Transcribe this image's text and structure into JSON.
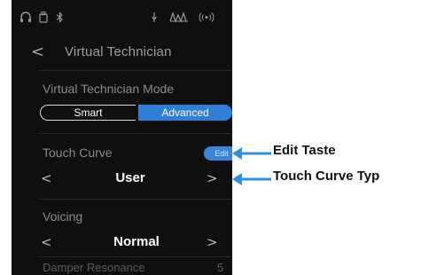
{
  "status_icons": [
    {
      "name": "headphones-icon",
      "glyph": "∩"
    },
    {
      "name": "usb-storage-icon",
      "glyph": "▯"
    },
    {
      "name": "bluetooth-icon",
      "glyph": "∗"
    },
    {
      "name": "microphone-icon",
      "glyph": "↓"
    },
    {
      "name": "metronome-icon",
      "glyph": "⌇"
    },
    {
      "name": "wireless-icon",
      "glyph": "((•))"
    }
  ],
  "header": {
    "back_glyph": "<",
    "title": "Virtual Technician"
  },
  "mode": {
    "label": "Virtual Technician Mode",
    "options": [
      "Smart",
      "Advanced"
    ],
    "selected": "Advanced"
  },
  "touch_curve": {
    "label": "Touch Curve",
    "edit_label": "Edit",
    "value": "User",
    "prev_glyph": "<",
    "next_glyph": ">"
  },
  "voicing": {
    "label": "Voicing",
    "value": "Normal",
    "prev_glyph": "<",
    "next_glyph": ">"
  },
  "next_row": {
    "label": "Damper Resonance",
    "value": "5"
  },
  "callouts": [
    {
      "label": "Edit Taste"
    },
    {
      "label": "Touch Curve Typ"
    }
  ],
  "colors": {
    "screen_bg": "#0f0f10",
    "accent": "#2f7fd6",
    "callout_arrow": "#2f8fe0"
  }
}
